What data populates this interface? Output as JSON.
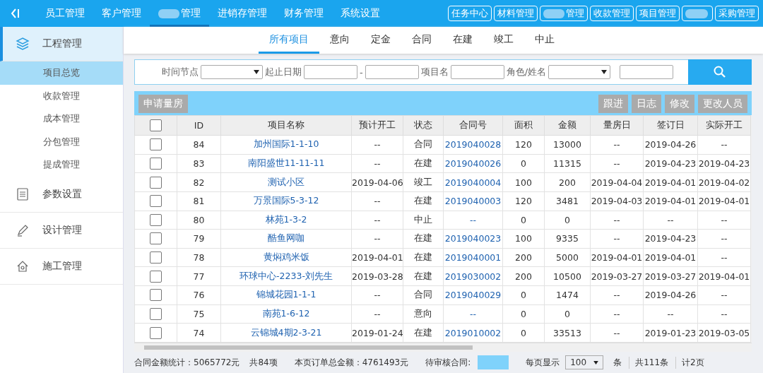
{
  "top_nav": {
    "items": [
      {
        "label": "员工管理",
        "selected": false,
        "redacted": false
      },
      {
        "label": "客户管理",
        "selected": false,
        "redacted": false
      },
      {
        "label": "管理",
        "selected": true,
        "redacted": true
      },
      {
        "label": "进销存管理",
        "selected": false,
        "redacted": false
      },
      {
        "label": "财务管理",
        "selected": false,
        "redacted": false
      },
      {
        "label": "系统设置",
        "selected": false,
        "redacted": false
      }
    ],
    "buttons": [
      {
        "label": "任务中心",
        "redacted": false
      },
      {
        "label": "材料管理",
        "redacted": false
      },
      {
        "label": "管理",
        "redacted": true
      },
      {
        "label": "收款管理",
        "redacted": false
      },
      {
        "label": "项目管理",
        "redacted": false
      },
      {
        "kind": "redacted"
      },
      {
        "label": "采购管理",
        "redacted": false
      }
    ]
  },
  "sidebar": {
    "sections": [
      {
        "label": "工程管理",
        "expanded": true,
        "children": [
          {
            "label": "项目总览",
            "selected": true
          },
          {
            "label": "收款管理",
            "selected": false
          },
          {
            "label": "成本管理",
            "selected": false
          },
          {
            "label": "分包管理",
            "selected": false
          },
          {
            "label": "提成管理",
            "selected": false
          }
        ]
      },
      {
        "label": "参数设置",
        "expanded": false
      },
      {
        "label": "设计管理",
        "expanded": false
      },
      {
        "label": "施工管理",
        "expanded": false
      }
    ]
  },
  "tabs": [
    {
      "label": "所有项目",
      "selected": true
    },
    {
      "label": "意向",
      "selected": false
    },
    {
      "label": "定金",
      "selected": false
    },
    {
      "label": "合同",
      "selected": false
    },
    {
      "label": "在建",
      "selected": false
    },
    {
      "label": "竣工",
      "selected": false
    },
    {
      "label": "中止",
      "selected": false
    }
  ],
  "filters": [
    {
      "kind": "select",
      "label": "时间节点"
    },
    {
      "kind": "range",
      "label": "起止日期",
      "separator": "-"
    },
    {
      "kind": "text",
      "label": "项目名"
    },
    {
      "kind": "select",
      "label": "角色/姓名"
    },
    {
      "kind": "text"
    }
  ],
  "toolbar": {
    "left": [
      "申请量房"
    ],
    "right": [
      "跟进",
      "日志",
      "修改",
      "更改人员"
    ]
  },
  "table": {
    "all_checked": false,
    "columns": [
      "ID",
      "项目名称",
      "预计开工",
      "状态",
      "合同号",
      "面积",
      "金额",
      "量房日",
      "签订日",
      "实际开工"
    ],
    "rows": [
      {
        "checked": false,
        "cells": [
          "84",
          "加州国际1-1-10",
          "--",
          "合同",
          "2019040028",
          "120",
          "13000",
          "--",
          "2019-04-26",
          "--"
        ]
      },
      {
        "checked": false,
        "cells": [
          "83",
          "南阳盛世11-11-11",
          "--",
          "在建",
          "2019040026",
          "0",
          "11315",
          "--",
          "2019-04-23",
          "2019-04-23"
        ]
      },
      {
        "checked": false,
        "cells": [
          "82",
          "测试小区",
          "2019-04-06",
          "竣工",
          "2019040004",
          "100",
          "200",
          "2019-04-04",
          "2019-04-01",
          "2019-04-02"
        ]
      },
      {
        "checked": false,
        "cells": [
          "81",
          "万景国际5-3-12",
          "--",
          "在建",
          "2019040003",
          "120",
          "3481",
          "2019-04-03",
          "2019-04-01",
          "2019-04-01"
        ]
      },
      {
        "checked": false,
        "cells": [
          "80",
          "林苑1-3-2",
          "--",
          "中止",
          "--",
          "0",
          "0",
          "--",
          "--",
          "--"
        ]
      },
      {
        "checked": false,
        "cells": [
          "79",
          "酷鱼网咖",
          "--",
          "在建",
          "2019040023",
          "100",
          "9335",
          "--",
          "2019-04-23",
          "--"
        ]
      },
      {
        "checked": false,
        "cells": [
          "78",
          "黄焖鸡米饭",
          "2019-04-01",
          "在建",
          "2019040001",
          "200",
          "5000",
          "2019-04-01",
          "2019-04-01",
          "--"
        ]
      },
      {
        "checked": false,
        "cells": [
          "77",
          "环球中心-2233-刘先生",
          "2019-03-28",
          "在建",
          "2019030002",
          "200",
          "10500",
          "2019-03-27",
          "2019-03-27",
          "2019-04-01"
        ]
      },
      {
        "checked": false,
        "cells": [
          "76",
          "锦城花园1-1-1",
          "--",
          "合同",
          "2019040029",
          "0",
          "1474",
          "--",
          "2019-04-26",
          "--"
        ]
      },
      {
        "checked": false,
        "cells": [
          "75",
          "南苑1-6-12",
          "--",
          "意向",
          "--",
          "0",
          "0",
          "--",
          "--",
          "--"
        ]
      },
      {
        "checked": false,
        "cells": [
          "74",
          "云锦城4期2-3-21",
          "2019-01-24",
          "在建",
          "2019010002",
          "0",
          "33513",
          "--",
          "2019-01-23",
          "2019-03-05"
        ]
      }
    ]
  },
  "footer": {
    "contract_total": "合同金额统计：5065772元",
    "count": "共84项",
    "page_total": "本页订单总金额：4761493元",
    "pending_label": "待审核合同:",
    "page_size_label": "每页显示",
    "page_size": "100",
    "page_size_unit": "条",
    "total": "共111条",
    "pages": "计2页"
  }
}
